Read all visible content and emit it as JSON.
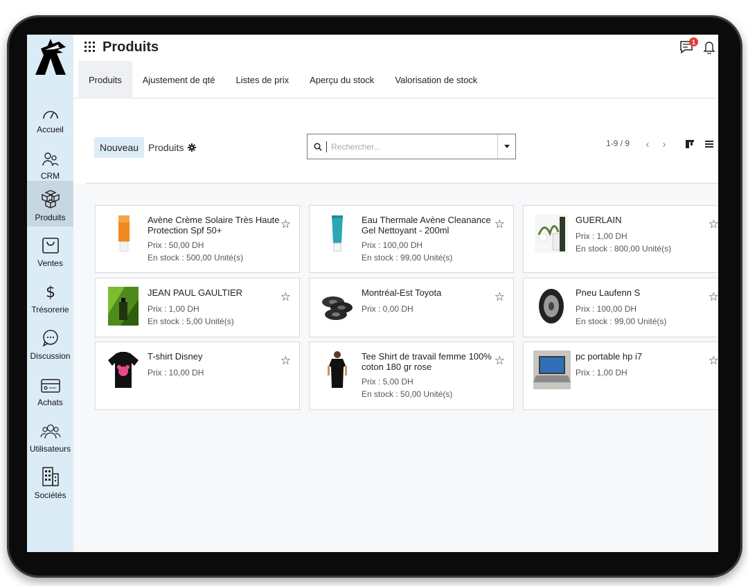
{
  "app": {
    "title": "Produits"
  },
  "header": {
    "notification_count": "1"
  },
  "tabs": [
    {
      "label": "Produits"
    },
    {
      "label": "Ajustement de qté"
    },
    {
      "label": "Listes de prix"
    },
    {
      "label": "Aperçu du stock"
    },
    {
      "label": "Valorisation de stock"
    }
  ],
  "sidebar": {
    "items": [
      {
        "label": "Accueil",
        "icon": "gauge-icon"
      },
      {
        "label": "CRM",
        "icon": "users-icon"
      },
      {
        "label": "Produits",
        "icon": "boxes-icon"
      },
      {
        "label": "Ventes",
        "icon": "bag-icon"
      },
      {
        "label": "Trésorerie",
        "icon": "dollar-icon"
      },
      {
        "label": "Discussion",
        "icon": "chat-icon"
      },
      {
        "label": "Achats",
        "icon": "card-icon"
      },
      {
        "label": "Utilisateurs",
        "icon": "group-icon"
      },
      {
        "label": "Sociétés",
        "icon": "building-icon"
      }
    ]
  },
  "control": {
    "new_label": "Nouveau",
    "breadcrumb": "Produits",
    "search_placeholder": "Rechercher...",
    "pager": "1-9 / 9"
  },
  "products": [
    {
      "name": "Avène Crème Solaire Très Haute Protection Spf 50+",
      "price": "Prix : 50,00 DH",
      "stock": "En stock : 500,00 Unité(s)",
      "image": "sunscreen"
    },
    {
      "name": "Eau Thermale Avène Cleanance Gel Nettoyant - 200ml",
      "price": "Prix : 100,00 DH",
      "stock": "En stock : 99,00 Unité(s)",
      "image": "tube"
    },
    {
      "name": "GUERLAIN",
      "price": "Prix : 1,00 DH",
      "stock": "En stock : 800,00 Unité(s)",
      "image": "perfume-white"
    },
    {
      "name": "JEAN PAUL GAULTIER",
      "price": "Prix : 1,00 DH",
      "stock": "En stock : 5,00 Unité(s)",
      "image": "perfume-green"
    },
    {
      "name": "Montréal-Est Toyota",
      "price": "Prix : 0,00 DH",
      "stock": "",
      "image": "tires"
    },
    {
      "name": "Pneu Laufenn S",
      "price": "Prix : 100,00 DH",
      "stock": "En stock : 99,00 Unité(s)",
      "image": "tire"
    },
    {
      "name": "T-shirt Disney",
      "price": "Prix : 10,00 DH",
      "stock": "",
      "image": "tshirt"
    },
    {
      "name": "Tee Shirt de travail femme 100% coton 180 gr rose",
      "price": "Prix : 5,00 DH",
      "stock": "En stock : 50,00 Unité(s)",
      "image": "tshirt-woman"
    },
    {
      "name": "pc portable hp i7",
      "price": "Prix : 1,00 DH",
      "stock": "",
      "image": "laptop"
    }
  ],
  "colors": {
    "sidebar": "#dcecf7",
    "sidebar_active": "#c6d7e2",
    "badge": "#e53935"
  }
}
